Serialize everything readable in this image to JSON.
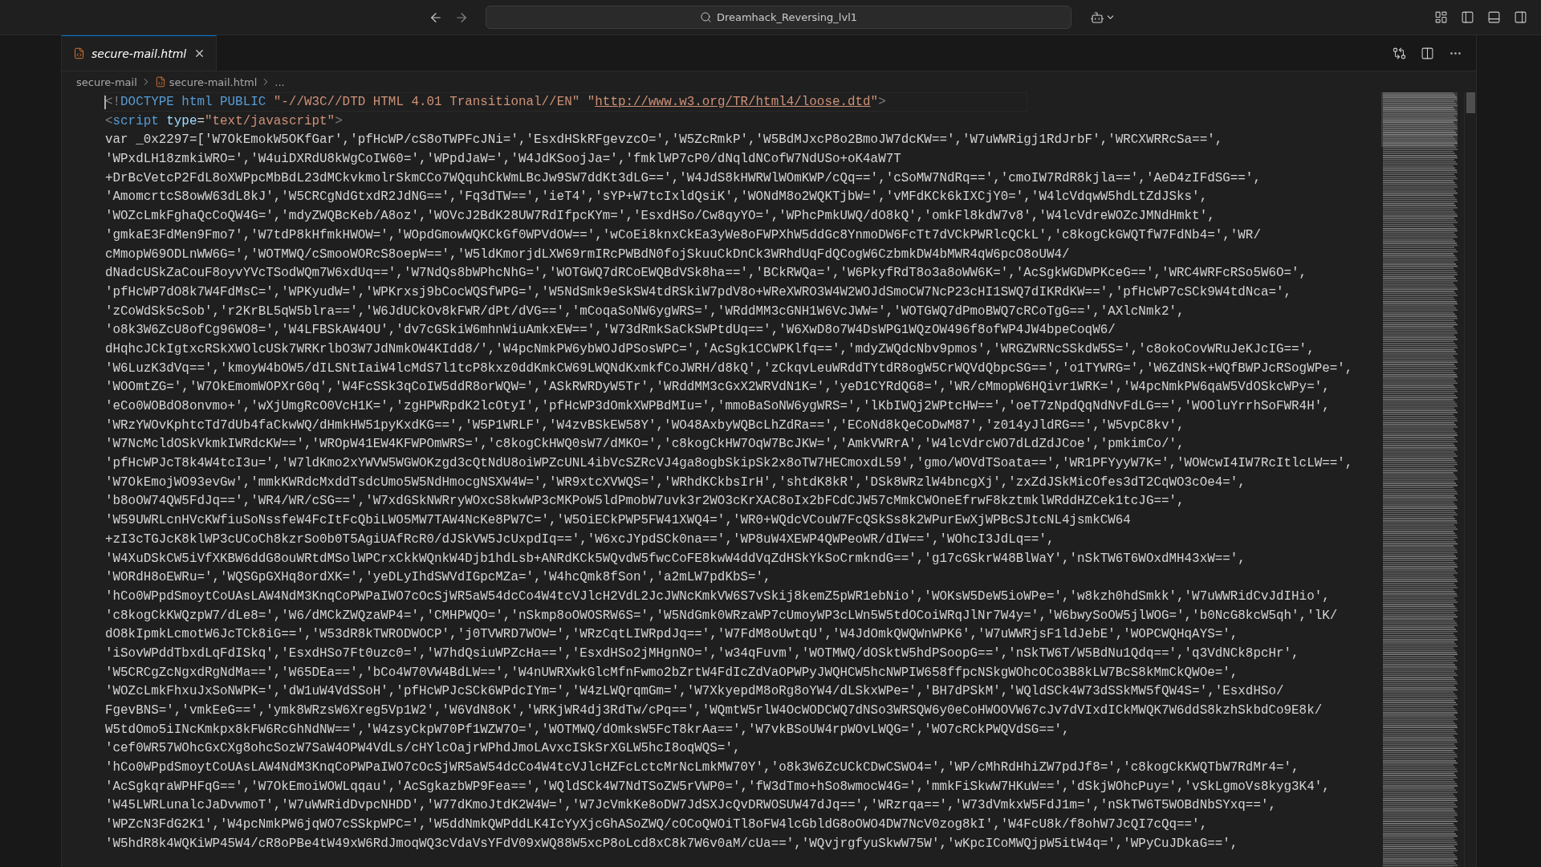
{
  "title_bar": {
    "search": "Dreamhack_Reversing_lvl1"
  },
  "tabs": [
    {
      "label": "secure-mail.html",
      "selected": true
    }
  ],
  "breadcrumb": [
    "secure-mail",
    "secure-mail.html",
    "..."
  ],
  "lines": [
    {
      "current": true,
      "tokens": [
        {
          "text": "<!",
          "kind": "punct"
        },
        {
          "text": "DOCTYPE html PUBLIC",
          "kind": "keyword"
        },
        {
          "text": " \"-//W3C//DTD HTML 4.01 Transitional//EN\" \"",
          "kind": "string"
        },
        {
          "text": "http://www.w3.org/TR/html4/loose.dtd",
          "kind": "link"
        },
        {
          "text": "\"",
          "kind": "string"
        },
        {
          "text": ">",
          "kind": "punct"
        }
      ]
    },
    {
      "current": false,
      "tokens": [
        {
          "text": "<",
          "kind": "punct"
        },
        {
          "text": "script",
          "kind": "keyword"
        },
        {
          "text": " type",
          "kind": "attr"
        },
        {
          "text": "=",
          "kind": "plain"
        },
        {
          "text": "\"text/javascript\"",
          "kind": "string"
        },
        {
          "text": ">",
          "kind": "punct"
        }
      ]
    },
    {
      "current": false,
      "tokens": [
        {
          "text": "var _0x2297=['W7OkEmokW5OKfGar','pfHcWP/cS8oTWPFcJNi=','EsxdHSkRFgevzcO=','W5ZcRmkP','W5BdMJxcP8o2BmoJW7dcKW==','W7uWWRigj1RdJrbF','WRCXWRRcSa==',",
          "kind": "plain"
        }
      ]
    },
    {
      "current": false,
      "tokens": [
        {
          "text": "'WPxdLH18zmkiWRO=','W4uiDXRdU8kWgCoIW60=','WPpdJaW=','W4JdKSoojJa=','fmklWP7cP0/dNqldNCofW7NdUSo+oK4aW7T",
          "kind": "plain"
        }
      ]
    },
    {
      "current": false,
      "tokens": [
        {
          "text": "+DrBcVetcP2FdL8oXWPpcMbBdL23dMCkvkmolrSkmCCo7WQquhCkWmLBcJw9SW7ddKt3dLG==','W4JdS8kHWRWlWOmKWP/cQq==','cSoMW7NdRq==','cmoIW7RdR8kjla==','AeD4zIFdSG==',",
          "kind": "plain"
        }
      ]
    },
    {
      "current": false,
      "tokens": [
        {
          "text": "'AmomcrtcS8owW63dL8kJ','W5CRCgNdGtxdR2JdNG==','Fq3dTW==','ieT4','sYP+W7tcIxldQsiK','WONdM8o2WQKTjbW=','vMFdKCk6kIXCjY0=','W4lcVdqwW5hdLtZdJSks',",
          "kind": "plain"
        }
      ]
    },
    {
      "current": false,
      "tokens": [
        {
          "text": "'WOZcLmkFghaQcCoQW4G=','mdyZWQBcKeb/A8oz','WOVcJ2BdK28UW7RdIfpcKYm=','EsxdHSo/Cw8qyYO=','WPhcPmkUWQ/dO8kQ','omkFl8kdW7v8','W4lcVdreWOZcJMNdHmkt',",
          "kind": "plain"
        }
      ]
    },
    {
      "current": false,
      "tokens": [
        {
          "text": "'gmkaE3FdMen9Fmo7','W7tdP8kHfmkHWOW=','WOpdGmowWQKCkGf0WPVdOW==','wCoEi8knxCkEa3yWe8oFWPXhW5ddGc8YnmoDW6FcTt7dVCkPWRlcQCkL','c8kogCkGWQTfW7FdNb4=','WR/",
          "kind": "plain"
        }
      ]
    },
    {
      "current": false,
      "tokens": [
        {
          "text": "cMmopW69ODLnWW6G=','WOTMWQ/cSmooWORcS8oepW==','W5ldKmorjdLXW69rmIRcPWBdN0fojSkuuCkDnCk3WRhdUqFdQCogW6CzbmkDW4bMWR4qW6pcO8oUW4/",
          "kind": "plain"
        }
      ]
    },
    {
      "current": false,
      "tokens": [
        {
          "text": "dNadcUSkZaCouF8oyvYVcTSodWQm7W6xdUq==','W7NdQs8bWPhcNhG=','WOTGWQ7dRCoEWQBdVSk8ha==','BCkRWQa=','W6PkyfRdT8o3a8oWW6K=','AcSgkWGDWPKceG==','WRC4WRFcRSo5W6O=',",
          "kind": "plain"
        }
      ]
    },
    {
      "current": false,
      "tokens": [
        {
          "text": "'pfHcWP7dO8k7W4FdMsC=','WPKyudW=','WPKrxsj9bCocWQSfWPG=','W5NdSmk9eSkSW4tdRSkiW7pdV8o+WReXWRO3W4W2WOJdSmoCW7NcP23cHI1SWQ7dIKRdKW==','pfHcWP7cSCk9W4tdNca=',",
          "kind": "plain"
        }
      ]
    },
    {
      "current": false,
      "tokens": [
        {
          "text": "'zCoWdSk5cSob','r2KrBL5qW5blra==','W6JdUCkOv8kFWR/dPt/dVG==','mCoqaSoNW6ygWRS=','WRddMM3cGNH1W6VcJWW=','WOTGWQ7dPmoBWQ7cRCoTgG==','AXlcNmk2',",
          "kind": "plain"
        }
      ]
    },
    {
      "current": false,
      "tokens": [
        {
          "text": "'o8k3W6ZcU8ofCg96WO8=','W4LFBSkAW4OU','dv7cGSkiW6mhnWiuAmkxEW==','W73dRmkSaCkSWPtdUq==','W6XwD8o7W4DsWPG1WQzOW496f8ofWP4JW4bpeCoqW6/",
          "kind": "plain"
        }
      ]
    },
    {
      "current": false,
      "tokens": [
        {
          "text": "dHqhcJCkIgtxcRSkXWOlcUSk7WRKrlbO3W7JdNmkOW4KIdd8/','W4pcNmkPW6ybWOJdPSosWPC=','AcSgk1CCWPKlfq==','mdyZWQdcNbv9pmos','WRGZWRNcSSkdW5S=','c8okoCovWRuJeKJcIG==',",
          "kind": "plain"
        }
      ]
    },
    {
      "current": false,
      "tokens": [
        {
          "text": "'W6LuzK3dVq==','kmoyW4bOW5/dILSNtIaiW4lcMdS7l1tcP8kxz0ddKmkCW69LWQNdKxmkfCoJWRH/d8kQ','zCkqvLeuWRddTYtdR8ogW5CrWQVdQbpcSG==','o1TYWRG=','W6ZdNSk+WQfBWPJcRSogWPe=',",
          "kind": "plain"
        }
      ]
    },
    {
      "current": false,
      "tokens": [
        {
          "text": "'WOOmtZG=','W7OkEmomWOPXrG0q','W4FcSSk3qCoIW5ddR8orWQW=','ASkRWRDyW5Tr','WRddMM3cGxX2WRVdN1K=','yeD1CYRdQG8=','WR/cMmopW6HQivr1WRK=','W4pcNmkPW6qaW5VdOSkcWPy=',",
          "kind": "plain"
        }
      ]
    },
    {
      "current": false,
      "tokens": [
        {
          "text": "'eCo0WOBdO8onvmo+','wXjUmgRcO0VcH1K=','zgHPWRpdK2lcOtyI','pfHcWP3dOmkXWPBdMIu=','mmoBaSoNW6ygWRS=','lKbIWQj2WPtcHW==','oeT7zNpdQqNdNvFdLG==','WOOluYrrhSoFWR4H',",
          "kind": "plain"
        }
      ]
    },
    {
      "current": false,
      "tokens": [
        {
          "text": "'WRzYWOvKphtcTd7dUb4faCkwWQ/dHmkHW51pyKxdKG==','W5P1WRLF','W4zvBSkEW58Y','WO48AxbyWQBcLhZdRa==','ECoNd8kQeCoDwM87','z014yJldRG==','W5vpC8kv',",
          "kind": "plain"
        }
      ]
    },
    {
      "current": false,
      "tokens": [
        {
          "text": "'W7NcMcldOSkVkmkIWRdcKW==','WROpW41EW4KFWPOmWRS=','c8kogCkHWQ0sW7/dMKO=','c8kogCkHW7OqW7BcJKW=','AmkVWRrA','W4lcVdrcWO7dLdZdJCoe','pmkimCo/',",
          "kind": "plain"
        }
      ]
    },
    {
      "current": false,
      "tokens": [
        {
          "text": "'pfHcWPJcT8k4W4tcI3u=','W7ldKmo2xYWVW5WGWOKzgd3cQtNdU8oiWPZcUNL4ibVcSZRcVJ4ga8ogbSkipSk2x8oTW7HECmoxdL59','gmo/WOVdTSoata==','WR1PFYyyW7K=','WOWcwI4IW7RcItlcLW==',",
          "kind": "plain"
        }
      ]
    },
    {
      "current": false,
      "tokens": [
        {
          "text": "'W7OkEmojWO93evGw','mmkKWRdcMxddTsdcUmo5W5NdHmocgNSXW4W=','WR9xtcXVWQS=','WRhdKCkbsIrH','shtdK8kR','DSk8WRzlW4bncgXj','zxZdJSkMicOfes3dT2CqWO3cOe4=',",
          "kind": "plain"
        }
      ]
    },
    {
      "current": false,
      "tokens": [
        {
          "text": "'b8oOW74QW5FdJq==','WR4/WR/cSG==','W7xdGSkNWRryWOxcS8kwWP3cMKPoW5ldPmobW7uvk3r2WO3cKrXAC8oIx2bFCdCJW57cMmkCWOneEfrwF8kztmklWRddHZCek1tcJG==',",
          "kind": "plain"
        }
      ]
    },
    {
      "current": false,
      "tokens": [
        {
          "text": "'W59UWRLcnHVcKWfiuSoNssfeW4FcItFcQbiLWO5MW7TAW4NcKe8PW7C=','W5OiECkPWP5FW41XWQ4=','WR0+WQdcVCouW7FcQSkSs8k2WPurEwXjWPBcSJtcNL4jsmkCW64",
          "kind": "plain"
        }
      ]
    },
    {
      "current": false,
      "tokens": [
        {
          "text": "+zI3cTGJcK8klWP3cUCoCh8kzrSo0b0T5AgiUAfRcR0/dJSkVW5JcUxpdIq==','W6xcJYpdSCk0na==','WP8uW4XEWP4QWPeoWR/dIW==','WOhcI3JdLq==',",
          "kind": "plain"
        }
      ]
    },
    {
      "current": false,
      "tokens": [
        {
          "text": "'W4XuDSkCW5iVfXKBW6ddG8ouWRtdMSolWPCrxCkkWQnkW4Djb1hdLsb+ANRdKCk5WQvdW5fwcCoFE8kwW4ddVqZdHSkYkSoCrmkndG==','g17cGSkrW48BlWaY','nSkTW6T6WOxdMH43xW==',",
          "kind": "plain"
        }
      ]
    },
    {
      "current": false,
      "tokens": [
        {
          "text": "'WORdH8oEWRu=','WQSGpGXHq8ordXK=','yeDLyIhdSWVdIGpcMZa=','W4hcQmk8fSon','a2mLW7pdKbS=',",
          "kind": "plain"
        }
      ]
    },
    {
      "current": false,
      "tokens": [
        {
          "text": "'hCo0WPpdSmoytCoUAsLAW4NdM3KnqCoPWPaIWO7cOcSjWR5aW54dcCo4W4tcVJlcH2VdL2JcJWNcKmkVW6S7vSkij8kemZ5pWR1ebNio','WOKsW5DeW5ioWPe=','w8kzh0hdSmkk','W7uWWRidCvJdIHio',",
          "kind": "plain"
        }
      ]
    },
    {
      "current": false,
      "tokens": [
        {
          "text": "'c8kogCkKWQzpW7/dLe8=','W6/dMCkZWQzaWP4=','CMHPWQO=','nSkmp8oOWOSRW6S=','W5NdGmk0WRzaWP7cUmoyWP3cLWn5W5tdOCoiWRqJlNr7W4y=','W6bwySoOW5jlWOG=','b0NcG8kcW5qh','lK/",
          "kind": "plain"
        }
      ]
    },
    {
      "current": false,
      "tokens": [
        {
          "text": "dO8kIpmkLcmotW6JcTCk8iG==','W53dR8kTWRODWOCP','j0TVWRD7WOW=','WRzCqtLIWRpdJq==','W7FdM8oUwtqU','W4JdOmkQWQWnWPK6','W7uWWRjsF1ldJebE','WOPCWQHqAYS=',",
          "kind": "plain"
        }
      ]
    },
    {
      "current": false,
      "tokens": [
        {
          "text": "'iSovWPddTbxdLqFdISkq','EsxdHSo7Ft0uzc0=','W7hdQsiuWPZcHa==','EsxdHSo2jMHgnNO=','w34qFuvm','WOTMWQ/dOSktW5hdPSoopG==','nSkTW6T/W5BdNu1Qdq==','q3VdNCk8pcHr',",
          "kind": "plain"
        }
      ]
    },
    {
      "current": false,
      "tokens": [
        {
          "text": "'W5CRCgZcNgxdRgNdMa==','W65DEa==','bCo4W70VW4BdLW==','W4nUWRXwkGlcMfnFwmo2bZrtW4FdIcZdVaOPWPyJWQHCW5hcNWPIW658ffpcNSkgWOhcOCo3B8kLW7BcS8kMmCkQWOe=',",
          "kind": "plain"
        }
      ]
    },
    {
      "current": false,
      "tokens": [
        {
          "text": "'WOZcLmkFhxuJxSoNWPK=','dW1uW4VdSSoH','pfHcWPJcSCk6WPdcIYm=','W4zLWQrqmGm=','W7XkyepdM8oRg8oYW4/dLSkxWPe=','BH7dPSkM','WQldSCk4W73dSSkMW5fQW4S=','EsxdHSo/",
          "kind": "plain"
        }
      ]
    },
    {
      "current": false,
      "tokens": [
        {
          "text": "FgevBNS=','vmkEeG==','ymk8WRzsW6Xreg5Vp1W2','W6VdN8oK','WRKjWR4dj3RdTw/cPq==','WQmtW5rlW4OcWODCWQ7dNSo3WRSQW6y0eCoHWOOVW67cJv7dVIxdICkMWQK7W6ddS8kzhSkbdCo9E8k/",
          "kind": "plain"
        }
      ]
    },
    {
      "current": false,
      "tokens": [
        {
          "text": "W5tdOmo5iINcKmkpx8kFW6RcGhNdNW==','W4zsyCkpW70Pf1WZW7O=','WOTMWQ/dOmksW5FcT8krAa==','W7vkBSoUW4rpWOvLWQG=','WO7cRCkPWQVdSG==',",
          "kind": "plain"
        }
      ]
    },
    {
      "current": false,
      "tokens": [
        {
          "text": "'cef0WR57WOhcGxCXg8ohcSozW7SaW4OPW4VdLs/cHYlcOajrWPhdJmoLAvxcISkSrXGLW5hcI8oqWQS=',",
          "kind": "plain"
        }
      ]
    },
    {
      "current": false,
      "tokens": [
        {
          "text": "'hCo0WPpdSmoytCoUAsLAW4NdM3KnqCoPWPaIWO7cOcSjWR5aW54dcCo4W4tcVJlcHZFcLctcMrNcLmkMW70Y','o8k3W6ZcUCkCDwCSWO4=','WP/cMhRdHhiZW7pdJf8=','c8kogCkKWQTbW7RdMr4=',",
          "kind": "plain"
        }
      ]
    },
    {
      "current": false,
      "tokens": [
        {
          "text": "'AcSgkqraWPHFqG==','W7OkEmoiWOWLqqau','AcSgkazbWP9Fea==','WQldSCk4W7NdTSoZW5rVWP0=','fW3dTmo+hSo8wmocW4G=','mmkFiSkwW7HKuW==','dSkjWOhcPuy=','vSkLgmoVs8kyg3K4',",
          "kind": "plain"
        }
      ]
    },
    {
      "current": false,
      "tokens": [
        {
          "text": "'W45LWRLunalcJaDvwmoT','W7uWWRidDvpcNHDD','W77dKmoJtdK2W4W=','W7JcVmkKe8oDW7JdSXJcQvDRWOSUW47dJq==','WRzrqa==','W73dVmkxW5FdJ1m=','nSkTW6T5WOBdNbSYxq==',",
          "kind": "plain"
        }
      ]
    },
    {
      "current": false,
      "tokens": [
        {
          "text": "'WPZcN3FdG2K1','W4pcNmkPW6jqWO7cSSkpWPC=','W5ddNmkQWPddLK4IcYyXjcGhASoZWQ/cOCoQWOiTl8oFW4lcGbldG8oOWO4DW7NcV0zog8kI','W4FcU8k/f8ohW7JcQI7cQq==',",
          "kind": "plain"
        }
      ]
    },
    {
      "current": false,
      "tokens": [
        {
          "text": "'W5hdR8k4WQKiWP45W4/cR8oPBe4tW49xW6RdJmoqWQ3cVdaVsYFdV09xWQ88W5xcP8oLcd8xC8k7W6v0aM/cUa==','WQvjrgfyuSkwW75W','wKpcICoMWQjpW5itW4q=','WPyCuJDkaG==',",
          "kind": "plain"
        }
      ]
    }
  ]
}
